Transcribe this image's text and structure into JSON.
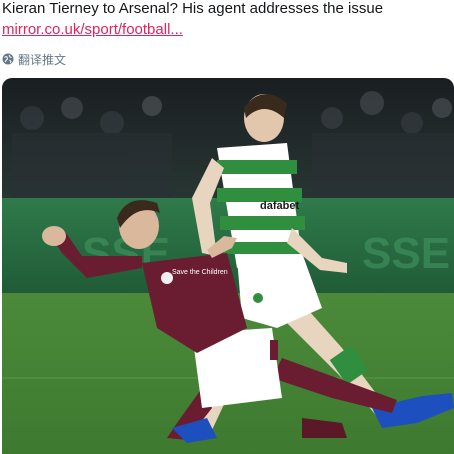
{
  "tweet": {
    "headline": "Kieran Tierney to Arsenal? His agent addresses the issue",
    "link_text": "mirror.co.uk/sport/football...",
    "translate_label": "翻译推文",
    "translate_icon": "globe-icon",
    "colors": {
      "text": "#14171a",
      "link": "#e0245e",
      "secondary": "#657786"
    }
  },
  "photo": {
    "players": [
      "maroon-kit-player",
      "green-white-hooped-player"
    ],
    "sponsor_text": "dafabet",
    "maroon_sponsor": "Save the Children"
  }
}
